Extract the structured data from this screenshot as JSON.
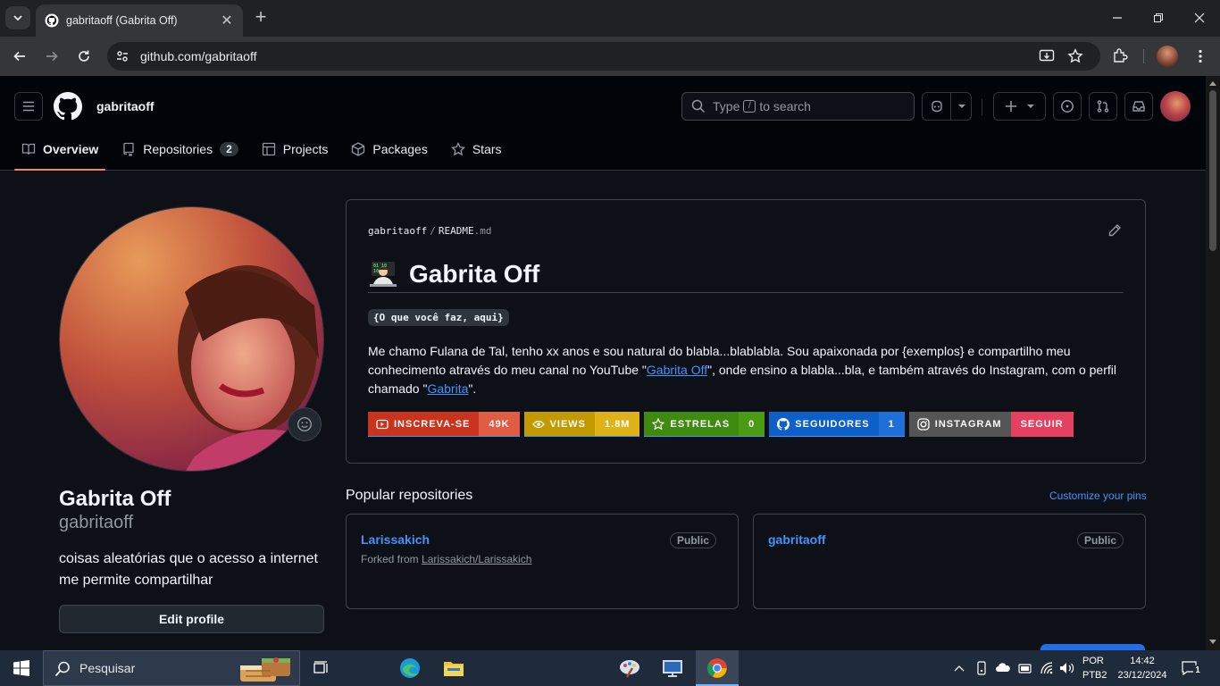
{
  "browser": {
    "tab_title": "gabritaoff (Gabrita Off)",
    "url": "github.com/gabritaoff"
  },
  "header": {
    "username": "gabritaoff",
    "search_prefix": "Type",
    "search_key": "/",
    "search_suffix": "to search"
  },
  "nav": {
    "overview": "Overview",
    "repositories": "Repositories",
    "repositories_count": "2",
    "projects": "Projects",
    "packages": "Packages",
    "stars": "Stars"
  },
  "profile": {
    "name": "Gabrita Off",
    "login": "gabritaoff",
    "bio": "coisas aleatórias que o acesso a internet me permite compartilhar",
    "edit_button": "Edit profile"
  },
  "readme": {
    "path_user": "gabritaoff",
    "path_sep": "/",
    "path_file": "README",
    "path_ext": ".md",
    "title": "Gabrita Off",
    "code_line": "{O que você faz, aqui}",
    "paragraph_1": "Me chamo Fulana de Tal, tenho xx anos e sou natural do blabla...blablabla. Sou apaixonada por {exemplos} e compartilho meu conhecimento através do meu canal no YouTube \"",
    "link_1": "Gabrita Off",
    "paragraph_2": "\", onde ensino a blabla...bla, e também através do Instagram, com o perfil chamado \"",
    "link_2": "Gabrita",
    "paragraph_3": "\".",
    "badges": [
      {
        "label": "INSCREVA-SE",
        "value": "49K",
        "left_color": "#c9341e",
        "right_color": "#e05d44",
        "icon": "youtube-icon"
      },
      {
        "label": "VIEWS",
        "value": "1.8M",
        "left_color": "#c29a00",
        "right_color": "#dfb317",
        "icon": "eye-icon"
      },
      {
        "label": "ESTRELAS",
        "value": "0",
        "left_color": "#3f8b10",
        "right_color": "#4c9a14",
        "icon": "star-icon"
      },
      {
        "label": "SEGUIDORES",
        "value": "1",
        "left_color": "#0d5fc9",
        "right_color": "#1f6fdb",
        "icon": "github-icon"
      },
      {
        "label": "INSTAGRAM",
        "value": "SEGUIR",
        "left_color": "#555555",
        "right_color": "#e4405f",
        "icon": "instagram-icon"
      }
    ]
  },
  "popular": {
    "title": "Popular repositories",
    "customize": "Customize your pins",
    "repos": [
      {
        "name": "Larissakich",
        "visibility": "Public",
        "forked_label": "Forked from ",
        "forked_from": "Larissakich/Larissakich"
      },
      {
        "name": "gabritaoff",
        "visibility": "Public"
      }
    ]
  },
  "taskbar": {
    "search_placeholder": "Pesquisar",
    "lang_1": "POR",
    "lang_2": "PTB2",
    "time": "14:42",
    "date": "23/12/2024",
    "notifications": "1"
  },
  "colors": {
    "accent": "#f78166",
    "link": "#4493f8",
    "bg": "#0d1117"
  }
}
